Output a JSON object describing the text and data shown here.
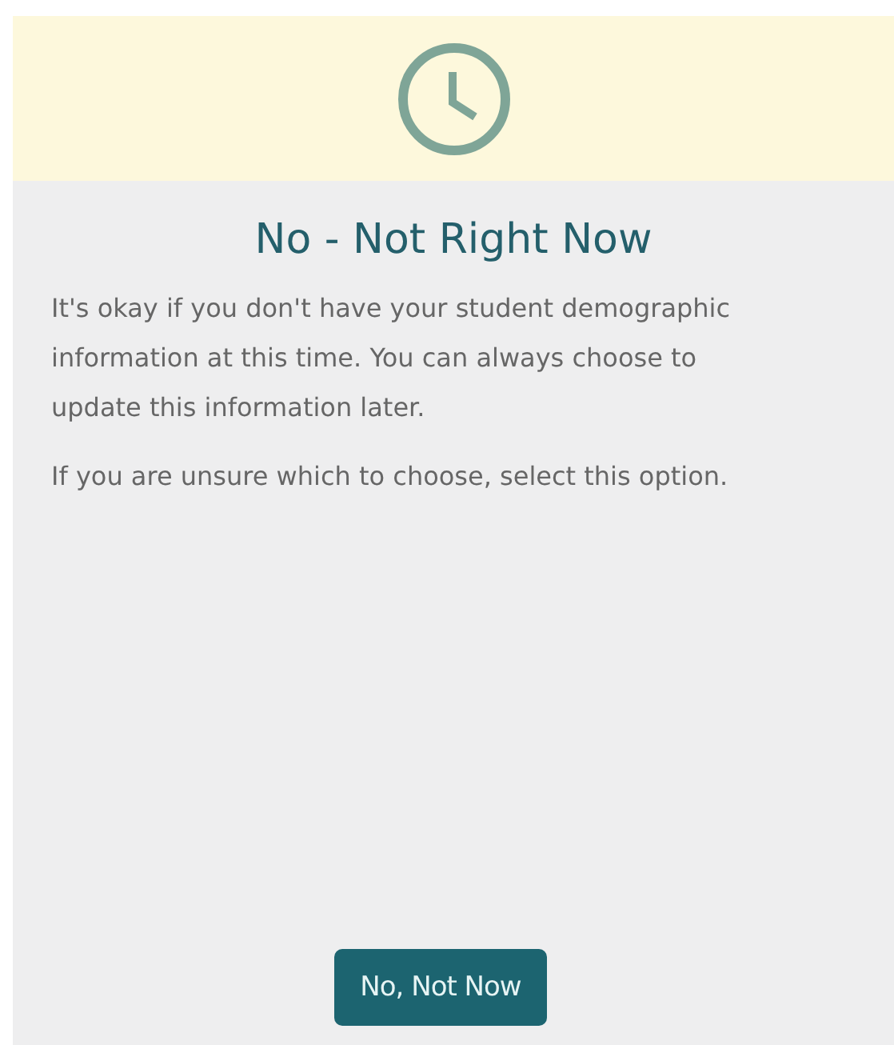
{
  "card": {
    "title": "No - Not Right Now",
    "paragraphs": [
      "It's okay if you don't have your student demographic information at this time. You can always choose to update this information later.",
      "If you are unsure which to choose, select this option."
    ],
    "button": "No, Not Now"
  }
}
